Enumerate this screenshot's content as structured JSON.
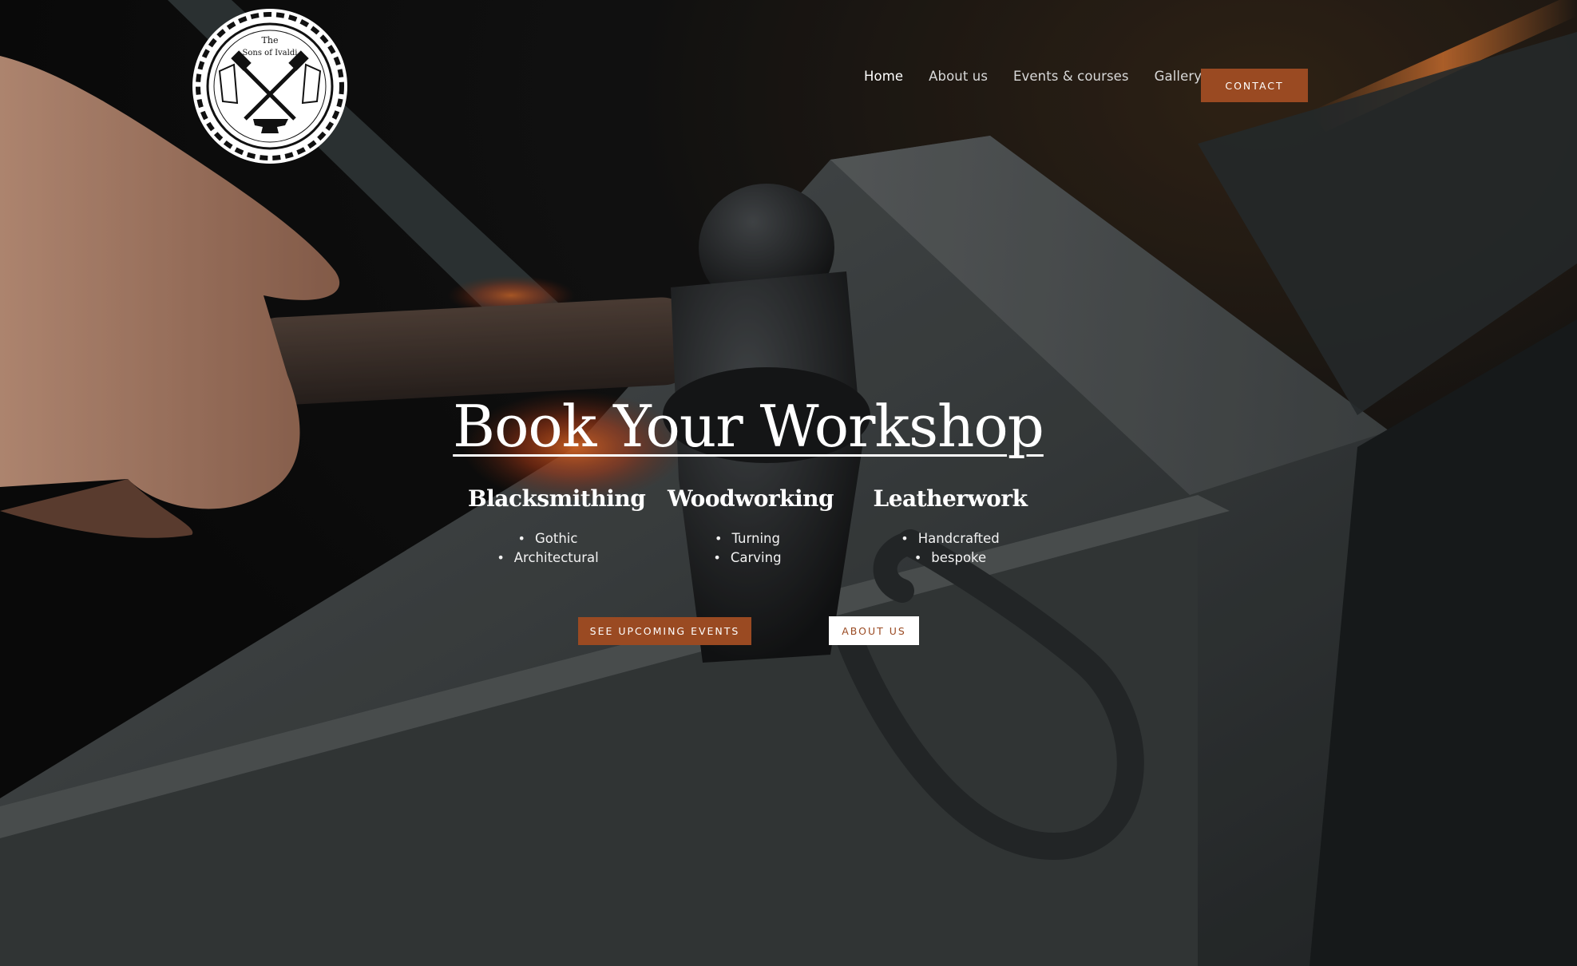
{
  "header": {
    "logo_text_line1": "The",
    "logo_text_line2": "Sons of Ivaldi",
    "nav": [
      {
        "label": "Home",
        "active": true
      },
      {
        "label": "About us",
        "active": false
      },
      {
        "label": "Events & courses",
        "active": false
      },
      {
        "label": "Gallery",
        "active": false
      }
    ],
    "contact_label": "CONTACT"
  },
  "hero": {
    "title": "Book Your Workshop",
    "columns": [
      {
        "heading": "Blacksmithing",
        "items": [
          "Gothic",
          "Architectural"
        ]
      },
      {
        "heading": "Woodworking",
        "items": [
          "Turning",
          "Carving"
        ]
      },
      {
        "heading": "Leatherwork",
        "items": [
          "Handcrafted",
          "bespoke"
        ]
      }
    ],
    "primary_button": "SEE UPCOMING EVENTS",
    "secondary_button": "ABOUT US"
  },
  "colors": {
    "accent": "#9a4a22",
    "text": "#ffffff"
  }
}
